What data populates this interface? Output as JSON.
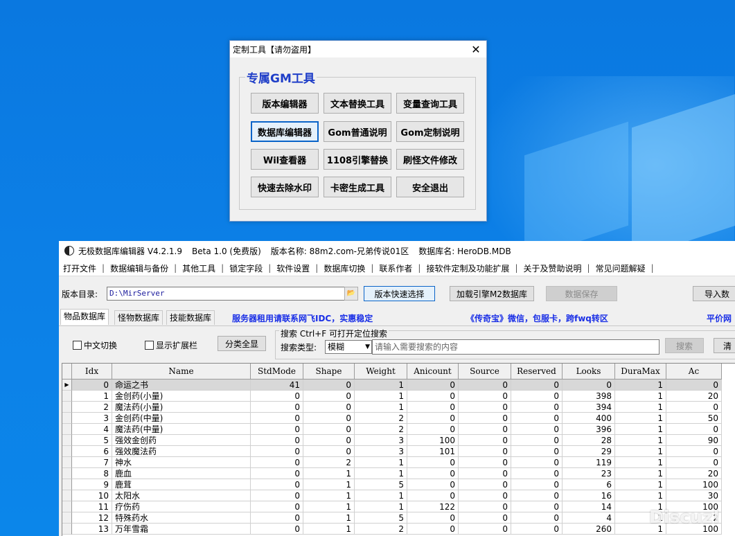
{
  "gm_window": {
    "title": "定制工具【请勿盗用】",
    "close": "✕",
    "group_title": "专属GM工具",
    "buttons": [
      [
        "版本编辑器",
        "文本替换工具",
        "变量查询工具"
      ],
      [
        "数据库编辑器",
        "Gom普通说明",
        "Gom定制说明"
      ],
      [
        "Wil查看器",
        "1108引擎替换",
        "刷怪文件修改"
      ],
      [
        "快速去除水印",
        "卡密生成工具",
        "安全退出"
      ]
    ]
  },
  "db_window": {
    "app_title": "无极数据库编辑器 V4.2.1.9",
    "beta": "Beta 1.0 (免费版)",
    "version_name": "版本名称: 88m2.com-兄弟传说01区",
    "db_name": "数据库名: HeroDB.MDB",
    "menu": [
      "打开文件",
      "数据编辑与备份",
      "其他工具",
      "锁定字段",
      "软件设置",
      "数据库切换",
      "联系作者",
      "接软件定制及功能扩展",
      "关于及赞助说明",
      "常见问题解疑"
    ],
    "dir_label": "版本目录:",
    "dir_value": "D:\\MirServer",
    "btn_quick_select": "版本快速选择",
    "btn_load_engine": "加载引擎M2数据库",
    "btn_save": "数据保存",
    "btn_import": "导入数",
    "tabs": [
      "物品数据库",
      "怪物数据库",
      "技能数据库"
    ],
    "ad1": "服务器租用请联系网飞IDC，实惠稳定",
    "ad2": "《传奇宝》微信，包服卡，跨fwq转区",
    "ad3": "平价网",
    "chk_chinese": "中文切换",
    "chk_ext": "显示扩展栏",
    "btn_category": "分类全显",
    "search_title": "搜索   Ctrl+F 可打开定位搜索",
    "search_type_label": "搜索类型:",
    "search_type_value": "模糊",
    "search_placeholder": "请输入需要搜索的内容",
    "btn_search": "搜索",
    "btn_clear": "清"
  },
  "grid": {
    "columns": [
      "Idx",
      "Name",
      "StdMode",
      "Shape",
      "Weight",
      "Anicount",
      "Source",
      "Reserved",
      "Looks",
      "DuraMax",
      "Ac"
    ],
    "rows": [
      [
        "0",
        "命运之书",
        "41",
        "0",
        "1",
        "0",
        "0",
        "0",
        "0",
        "1",
        "0"
      ],
      [
        "1",
        "金创药(小量)",
        "0",
        "0",
        "1",
        "0",
        "0",
        "0",
        "398",
        "1",
        "20"
      ],
      [
        "2",
        "魔法药(小量)",
        "0",
        "0",
        "1",
        "0",
        "0",
        "0",
        "394",
        "1",
        "0"
      ],
      [
        "3",
        "金创药(中量)",
        "0",
        "0",
        "2",
        "0",
        "0",
        "0",
        "400",
        "1",
        "50"
      ],
      [
        "4",
        "魔法药(中量)",
        "0",
        "0",
        "2",
        "0",
        "0",
        "0",
        "396",
        "1",
        "0"
      ],
      [
        "5",
        "强效金创药",
        "0",
        "0",
        "3",
        "100",
        "0",
        "0",
        "28",
        "1",
        "90"
      ],
      [
        "6",
        "强效魔法药",
        "0",
        "0",
        "3",
        "101",
        "0",
        "0",
        "29",
        "1",
        "0"
      ],
      [
        "7",
        "神水",
        "0",
        "2",
        "1",
        "0",
        "0",
        "0",
        "119",
        "1",
        "0"
      ],
      [
        "8",
        "鹿血",
        "0",
        "1",
        "1",
        "0",
        "0",
        "0",
        "23",
        "1",
        "20"
      ],
      [
        "9",
        "鹿茸",
        "0",
        "1",
        "5",
        "0",
        "0",
        "0",
        "6",
        "1",
        "100"
      ],
      [
        "10",
        "太阳水",
        "0",
        "1",
        "1",
        "0",
        "0",
        "0",
        "16",
        "1",
        "30"
      ],
      [
        "11",
        "疗伤药",
        "0",
        "1",
        "1",
        "122",
        "0",
        "0",
        "14",
        "1",
        "100"
      ],
      [
        "12",
        "特殊药水",
        "0",
        "1",
        "5",
        "0",
        "0",
        "0",
        "4",
        "1",
        "2"
      ],
      [
        "13",
        "万年雪霜",
        "0",
        "1",
        "2",
        "0",
        "0",
        "0",
        "260",
        "1",
        "100"
      ]
    ]
  },
  "watermark": "Discuz!"
}
